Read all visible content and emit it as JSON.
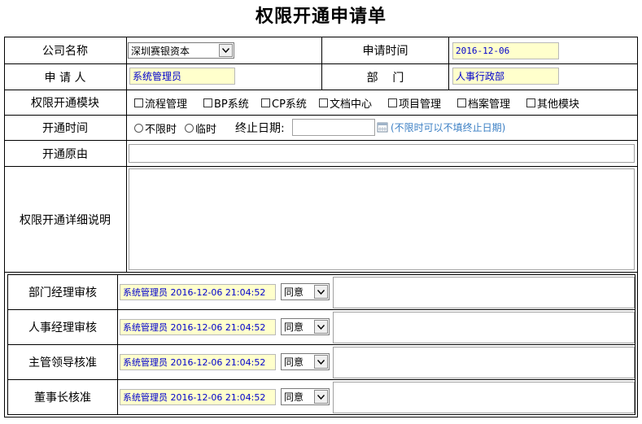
{
  "form": {
    "title": "权限开通申请单"
  },
  "company": {
    "label": "公司名称",
    "value": "深圳赛银资本"
  },
  "apply_time": {
    "label": "申请时间",
    "value": "2016-12-06"
  },
  "applicant": {
    "label": "申 请 人",
    "value": "系统管理员"
  },
  "department": {
    "label": "部    门",
    "value": "人事行政部"
  },
  "modules": {
    "label": "权限开通模块",
    "options": [
      "流程管理",
      "BP系统",
      "CP系统",
      "文档中心",
      "项目管理",
      "档案管理",
      "其他模块"
    ]
  },
  "open_time": {
    "label": "开通时间",
    "option_unlimited": "不限时",
    "option_temporary": "临时",
    "end_date_label": "终止日期:",
    "end_date_value": "",
    "hint": "(不限时可以不填终止日期)"
  },
  "reason": {
    "label": "开通原由",
    "value": ""
  },
  "details": {
    "label": "权限开通详细说明",
    "value": ""
  },
  "approvals": [
    {
      "label": "部门经理审核",
      "signer": "系统管理员 2016-12-06 21:04:52",
      "decision": "同意",
      "comment": ""
    },
    {
      "label": "人事经理审核",
      "signer": "系统管理员 2016-12-06 21:04:52",
      "decision": "同意",
      "comment": ""
    },
    {
      "label": "主管领导核准",
      "signer": "系统管理员 2016-12-06 21:04:52",
      "decision": "同意",
      "comment": ""
    },
    {
      "label": "董事长核准",
      "signer": "系统管理员 2016-12-06 21:04:52",
      "decision": "同意",
      "comment": ""
    }
  ],
  "colors": {
    "readonly_bg": "#ffffcc",
    "readonly_text": "#0000cc",
    "hint": "#3b7fc4"
  }
}
